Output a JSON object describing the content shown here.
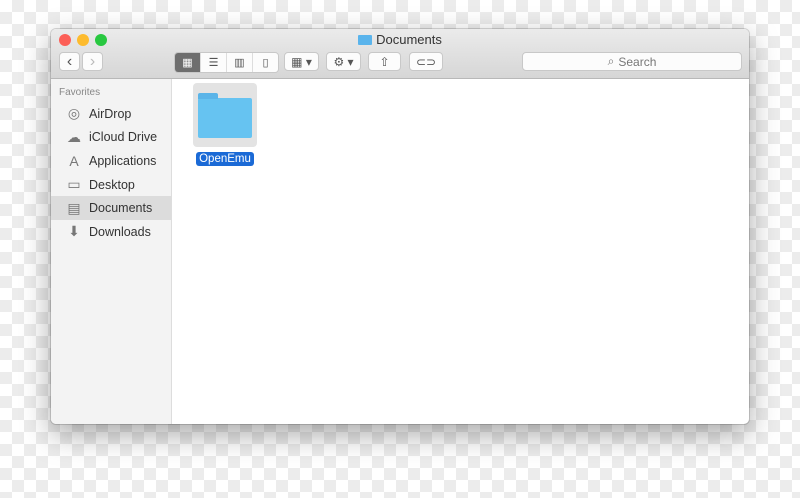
{
  "window": {
    "title": "Documents"
  },
  "toolbar": {
    "back": "‹",
    "forward": "›",
    "search_placeholder": "Search"
  },
  "sidebar": {
    "heading": "Favorites",
    "items": [
      {
        "label": "AirDrop",
        "icon": "◎"
      },
      {
        "label": "iCloud Drive",
        "icon": "☁"
      },
      {
        "label": "Applications",
        "icon": "A"
      },
      {
        "label": "Desktop",
        "icon": "▭"
      },
      {
        "label": "Documents",
        "icon": "▤"
      },
      {
        "label": "Downloads",
        "icon": "⬇"
      }
    ]
  },
  "files": [
    {
      "name": "OpenEmu"
    }
  ]
}
